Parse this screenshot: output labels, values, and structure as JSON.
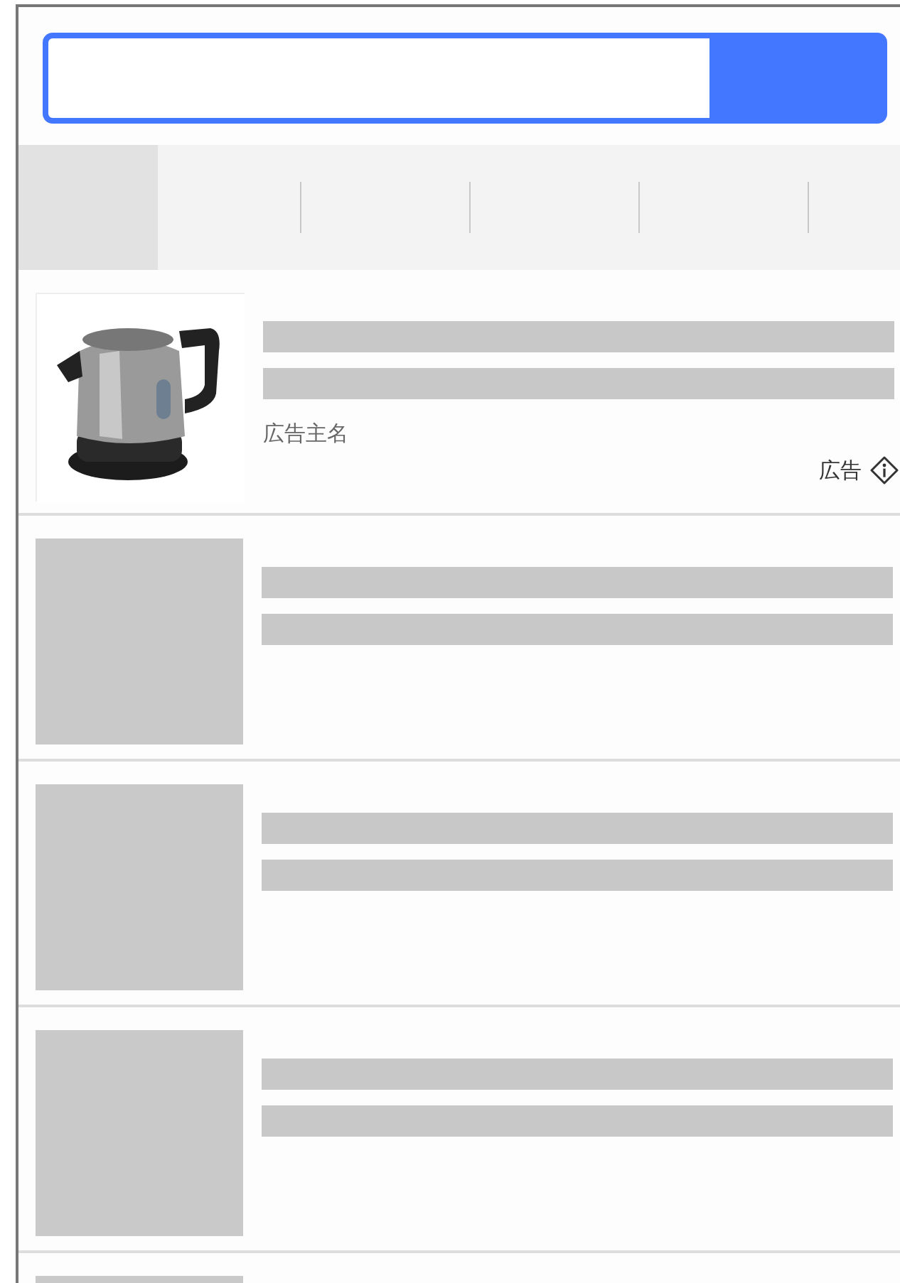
{
  "tabs": [
    {
      "selected": true
    },
    {
      "selected": false
    },
    {
      "selected": false
    },
    {
      "selected": false
    },
    {
      "selected": false
    }
  ],
  "results": [
    {
      "kind": "ad",
      "advertiser": "広告主名",
      "ad_label": "広告"
    },
    {
      "kind": "placeholder"
    },
    {
      "kind": "placeholder"
    },
    {
      "kind": "placeholder"
    },
    {
      "kind": "partial"
    }
  ]
}
